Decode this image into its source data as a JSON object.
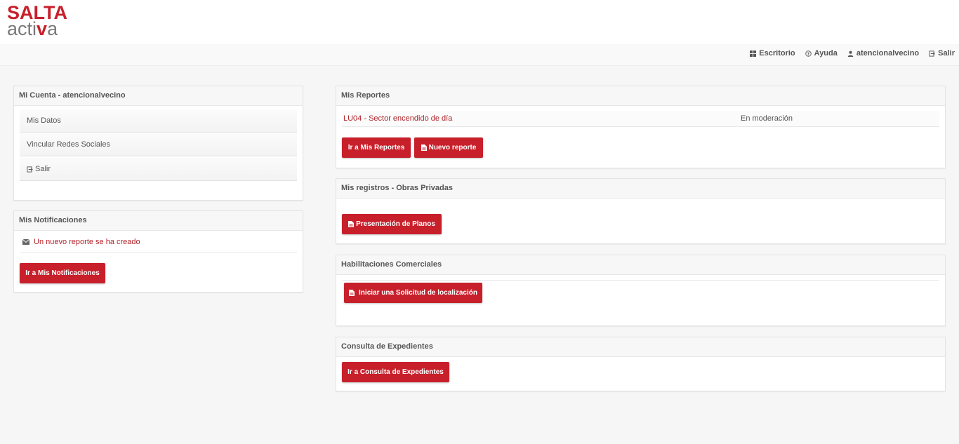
{
  "logo": {
    "line1": "SALTA",
    "line2a": "acti",
    "line2b": "v",
    "line2c": "a"
  },
  "nav": [
    {
      "icon": "grid-icon",
      "label": "Escritorio"
    },
    {
      "icon": "help-icon",
      "label": "Ayuda"
    },
    {
      "icon": "user-icon",
      "label": "atencionalvecino"
    },
    {
      "icon": "exit-icon",
      "label": "Salir"
    }
  ],
  "cuenta": {
    "title": "Mi Cuenta - atencionalvecino",
    "items": [
      "Mis Datos",
      "Vincular Redes Sociales",
      "Salir"
    ]
  },
  "notificaciones": {
    "title": "Mis Notificaciones",
    "item": "Un nuevo reporte se ha creado",
    "button": "Ir a Mis Notificaciones"
  },
  "reportes": {
    "title": "Mis Reportes",
    "row_label": "LU04 - Sector encendido de día",
    "row_status": "En moderación",
    "button1": "Ir a Mis Reportes",
    "button2": "Nuevo reporte"
  },
  "obras": {
    "title": "Mis registros - Obras Privadas",
    "button": "Presentación de Planos"
  },
  "habilitaciones": {
    "title": "Habilitaciones Comerciales",
    "button": "Iniciar una Solicitud de localización"
  },
  "expedientes": {
    "title": "Consulta de Expedientes",
    "button": "Ir a Consulta de Expedientes"
  },
  "colors": {
    "accent": "#c8202b",
    "link": "#b0242b",
    "background": "#f6f6f6"
  }
}
